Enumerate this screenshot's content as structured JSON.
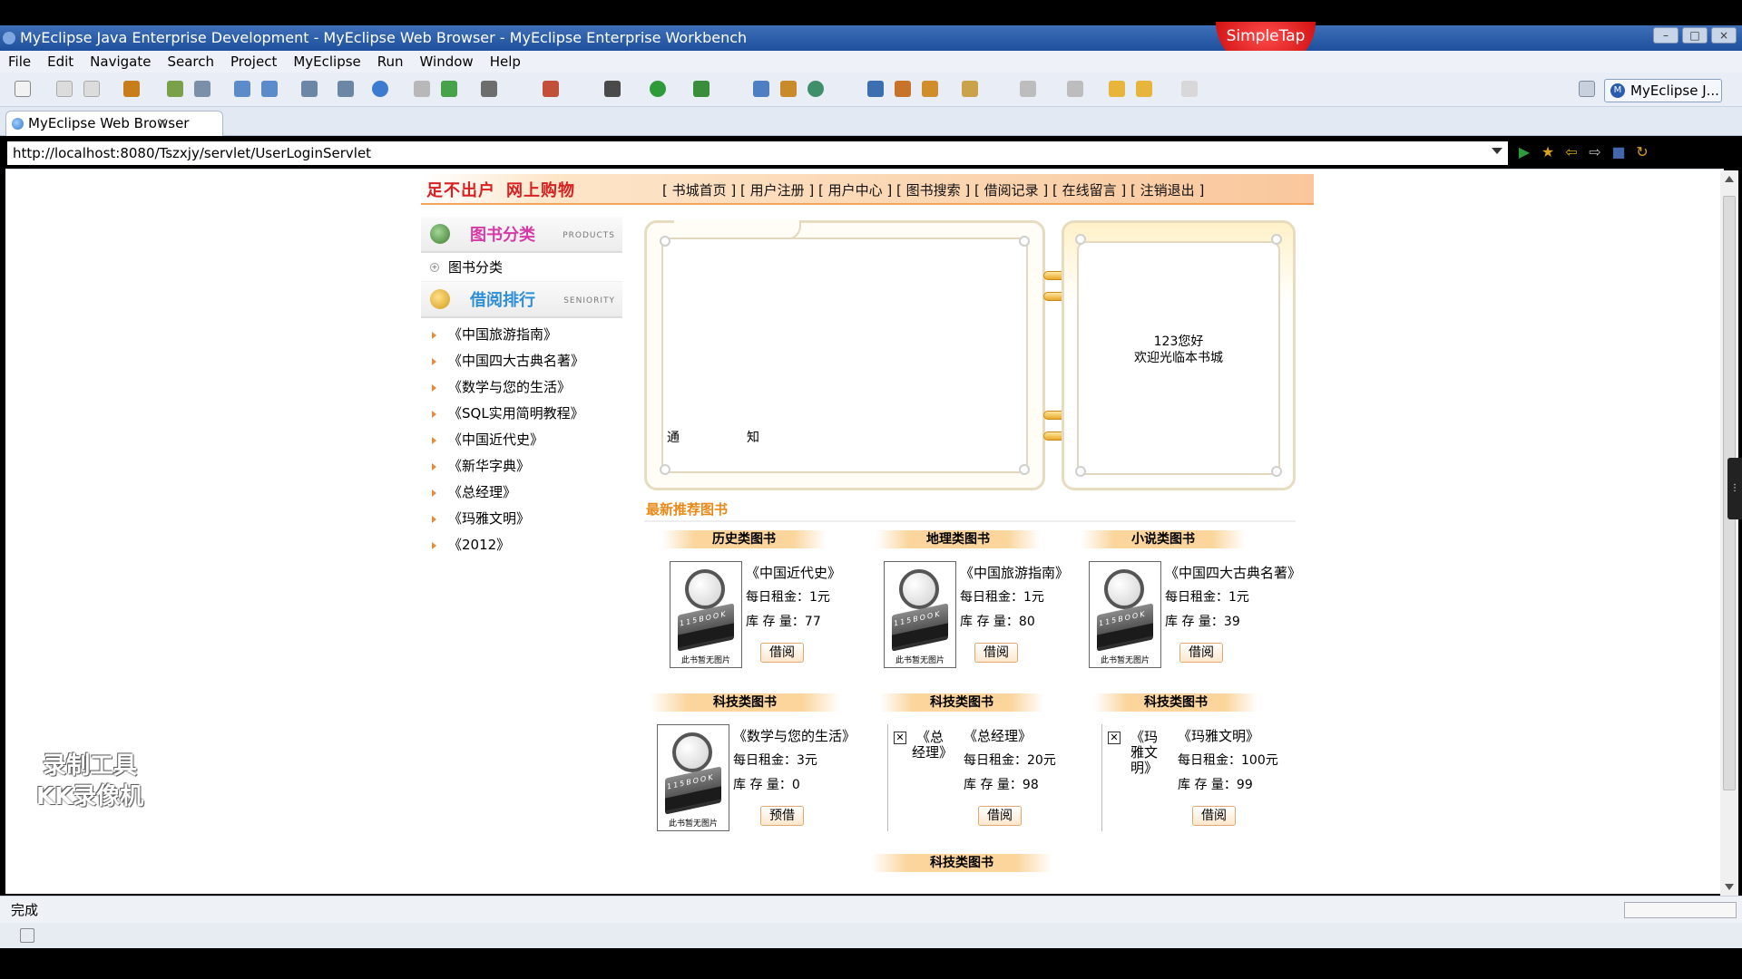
{
  "window": {
    "title": "MyEclipse Java Enterprise Development - MyEclipse Web Browser - MyEclipse Enterprise Workbench",
    "overlay_badge": "SimpleTap"
  },
  "menu": [
    "File",
    "Edit",
    "Navigate",
    "Search",
    "Project",
    "MyEclipse",
    "Run",
    "Window",
    "Help"
  ],
  "perspective_label": "MyEclipse J...",
  "tab": {
    "label": "MyEclipse Web Browser"
  },
  "address": {
    "url": "http://localhost:8080/Tszxjy/servlet/UserLoginServlet"
  },
  "status": {
    "text": "完成"
  },
  "watermark": {
    "line1": "录制工具",
    "line2": "KK录像机"
  },
  "site": {
    "brand": [
      "足不出户",
      "网上购物"
    ],
    "nav": "[ 书城首页 ] [ 用户注册 ] [ 用户中心 ] [ 图书搜索 ] [ 借阅记录 ] [ 在线留言 ] [ 注销退出 ]",
    "sidebar": {
      "category_title": "图书分类",
      "category_en": "PRODUCTS",
      "category_item": "图书分类",
      "rank_title": "借阅排行",
      "rank_en": "SENIORITY",
      "rank_items": [
        "《中国旅游指南》",
        "《中国四大古典名著》",
        "《数学与您的生活》",
        "《SQL实用简明教程》",
        "《中国近代史》",
        "《新华字典》",
        "《总经理》",
        "《玛雅文明》",
        "《2012》"
      ]
    },
    "notice": {
      "label1": "通",
      "label2": "知"
    },
    "welcome": {
      "line1": "123您好",
      "line2": "欢迎光临本书城"
    },
    "recommend_title": "最新推荐图书",
    "cover_stamp": "115BOOK",
    "cover_nopic": "此书暂无图片",
    "rent_label": "每日租金：",
    "stock_label": "库 存 量：",
    "books": [
      {
        "category": "历史类图书",
        "title": "《中国近代史》",
        "rent": "1元",
        "stock": "77",
        "button": "借阅"
      },
      {
        "category": "地理类图书",
        "title": "《中国旅游指南》",
        "rent": "1元",
        "stock": "80",
        "button": "借阅"
      },
      {
        "category": "小说类图书",
        "title": "《中国四大古典名著》",
        "rent": "1元",
        "stock": "39",
        "button": "借阅"
      },
      {
        "category": "科技类图书",
        "title": "《数学与您的生活》",
        "rent": "3元",
        "stock": "0",
        "button": "预借"
      },
      {
        "category": "科技类图书",
        "title": "《总经理》",
        "alt": "《总经理》",
        "rent": "20元",
        "stock": "98",
        "button": "借阅"
      },
      {
        "category": "科技类图书",
        "title": "《玛雅文明》",
        "alt": "《玛雅文明》",
        "rent": "100元",
        "stock": "99",
        "button": "借阅"
      }
    ],
    "next_category": "科技类图书"
  }
}
